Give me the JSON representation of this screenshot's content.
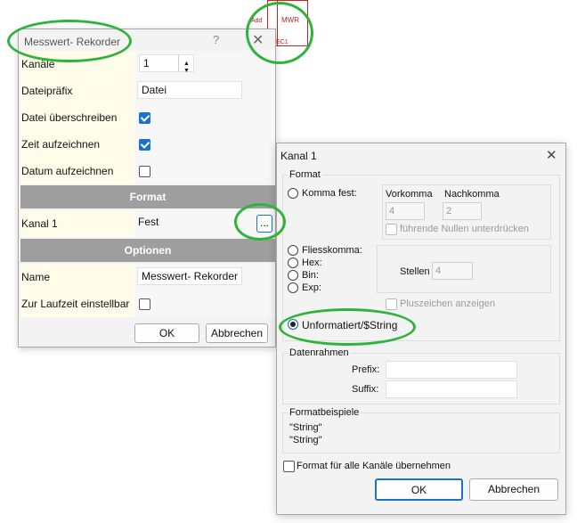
{
  "block": {
    "lines": [
      "MWR",
      "Add",
      "EC1"
    ]
  },
  "dialog1": {
    "title": "Messwert- Rekorder",
    "help_glyph": "?",
    "close_glyph": "✕",
    "rows": {
      "kanaele": {
        "label": "Kanäle",
        "value": "1"
      },
      "dateipraefix": {
        "label": "Dateipräfix",
        "value": "Datei"
      },
      "datei_ueberschreiben": {
        "label": "Datei überschreiben",
        "checked": true
      },
      "zeit_aufzeichnen": {
        "label": "Zeit aufzeichnen",
        "checked": true
      },
      "datum_aufzeichnen": {
        "label": "Datum aufzeichnen",
        "checked": false
      },
      "kanal1": {
        "label": "Kanal 1",
        "value": "Fest",
        "button": "..."
      },
      "name": {
        "label": "Name",
        "value": "Messwert- Rekorder"
      },
      "laufzeit": {
        "label": "Zur Laufzeit einstellbar",
        "checked": false
      }
    },
    "section_format": "Format",
    "section_optionen": "Optionen",
    "ok": "OK",
    "cancel": "Abbrechen"
  },
  "dialog2": {
    "title": "Kanal 1",
    "close_glyph": "✕",
    "format_group": "Format",
    "komma_fest": "Komma fest:",
    "vorkomma_label": "Vorkomma",
    "vorkomma_value": "4",
    "nachkomma_label": "Nachkomma",
    "nachkomma_value": "2",
    "fuehrende_nullen": "führende Nullen unterdrücken",
    "fliesskomma": "Fliesskomma:",
    "hex": "Hex:",
    "bin": "Bin:",
    "exp": "Exp:",
    "stellen_label": "Stellen",
    "stellen_value": "4",
    "pluszeichen": "Pluszeichen anzeigen",
    "unformatiert": "Unformatiert/$String",
    "selected_format": "unformatiert",
    "datenrahmen_group": "Datenrahmen",
    "prefix_label": "Prefix:",
    "prefix_value": "",
    "suffix_label": "Suffix:",
    "suffix_value": "",
    "beispiele_group": "Formatbeispiele",
    "beispiel1": "\"String\"",
    "beispiel2": "\"String\"",
    "alle_kanaele": "Format für alle Kanäle übernehmen",
    "ok": "OK",
    "cancel": "Abbrechen"
  }
}
